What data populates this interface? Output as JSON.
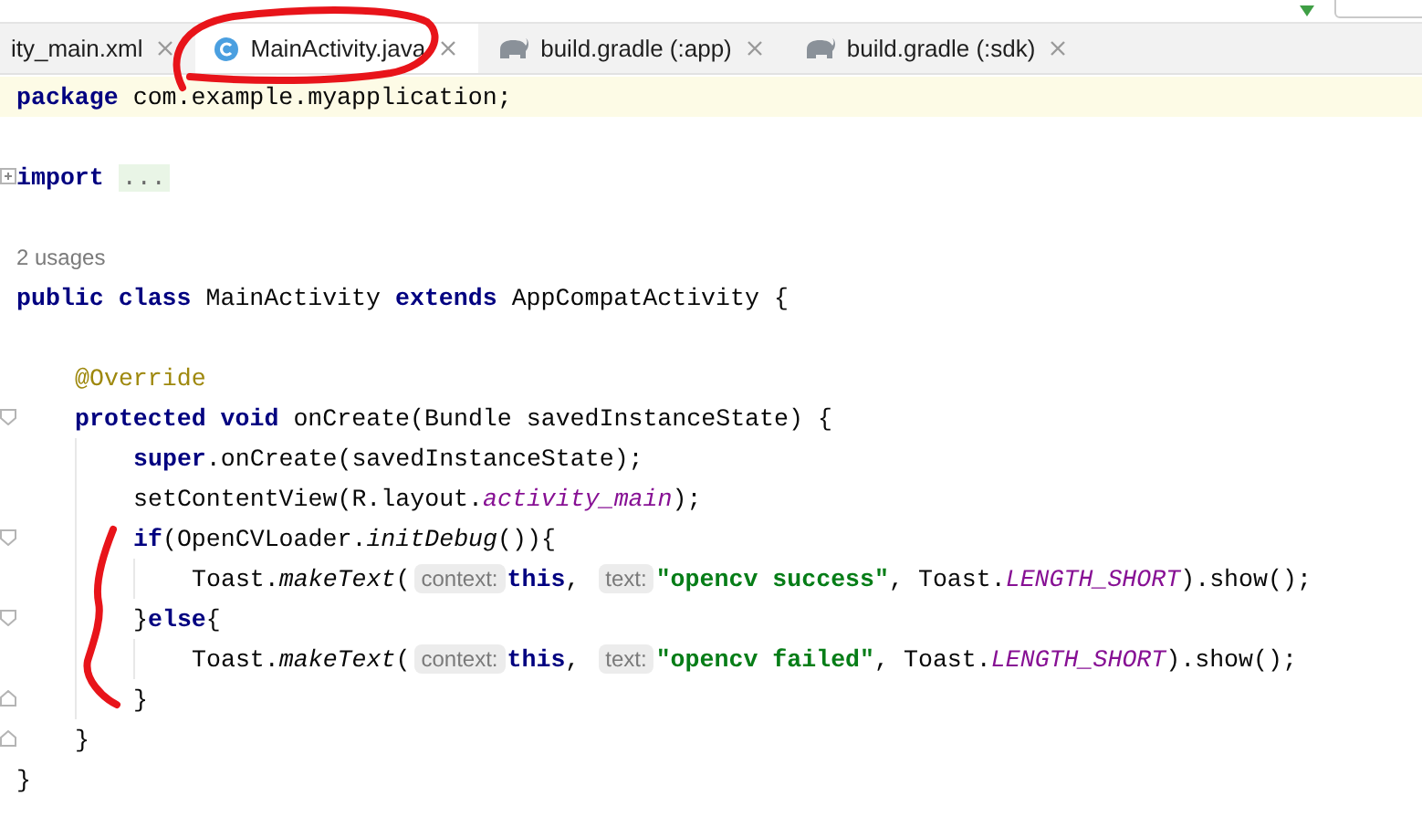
{
  "tabs": [
    {
      "label": "ity_main.xml",
      "kind": "xml",
      "selected": false
    },
    {
      "label": "MainActivity.java",
      "kind": "java",
      "selected": true
    },
    {
      "label": "build.gradle (:app)",
      "kind": "gradle",
      "selected": false
    },
    {
      "label": "build.gradle (:sdk)",
      "kind": "gradle",
      "selected": false
    }
  ],
  "lines": [
    {
      "current": true,
      "tokens": [
        {
          "kind": "kw",
          "text": "package"
        },
        {
          "kind": "plain",
          "text": " com.example.myapplication;"
        }
      ]
    },
    {
      "kind": "blank"
    },
    {
      "folded": true,
      "tokens": [
        {
          "kind": "kw",
          "text": "import"
        },
        {
          "kind": "fold",
          "text": "..."
        }
      ]
    },
    {
      "kind": "blank"
    },
    {
      "kind": "usages",
      "text": "2 usages"
    },
    {
      "tokens": [
        {
          "kind": "kw",
          "text": "public class"
        },
        {
          "kind": "plain",
          "text": " MainActivity "
        },
        {
          "kind": "kw",
          "text": "extends"
        },
        {
          "kind": "plain",
          "text": " AppCompatActivity {"
        }
      ],
      "children": [
        {
          "kind": "blank"
        },
        {
          "tokens": [
            {
              "kind": "annot",
              "text": "@Override"
            }
          ]
        },
        {
          "tokens": [
            {
              "kind": "kw",
              "text": "protected void"
            },
            {
              "kind": "plain",
              "text": " onCreate(Bundle savedInstanceState) {"
            }
          ],
          "children": [
            {
              "tokens": [
                {
                  "kind": "kw",
                  "text": "super"
                },
                {
                  "kind": "plain",
                  "text": ".onCreate(savedInstanceState);"
                }
              ]
            },
            {
              "tokens": [
                {
                  "kind": "plain",
                  "text": "setContentView(R.layout."
                },
                {
                  "kind": "static",
                  "text": "activity_main"
                },
                {
                  "kind": "plain",
                  "text": ");"
                }
              ]
            },
            {
              "tokens": [
                {
                  "kind": "kw",
                  "text": "if"
                },
                {
                  "kind": "plain",
                  "text": "(OpenCVLoader."
                },
                {
                  "kind": "italic",
                  "text": "initDebug"
                },
                {
                  "kind": "plain",
                  "text": "()){"
                }
              ],
              "children": [
                {
                  "tokens": [
                    {
                      "kind": "plain",
                      "text": "Toast."
                    },
                    {
                      "kind": "italic",
                      "text": "makeText"
                    },
                    {
                      "kind": "plain",
                      "text": "("
                    },
                    {
                      "kind": "hint",
                      "text": "context:"
                    },
                    {
                      "kind": "kw",
                      "text": "this"
                    },
                    {
                      "kind": "plain",
                      "text": ", "
                    },
                    {
                      "kind": "hint",
                      "text": "text:"
                    },
                    {
                      "kind": "str",
                      "text": "\"opencv success\""
                    },
                    {
                      "kind": "plain",
                      "text": ", Toast."
                    },
                    {
                      "kind": "static",
                      "text": "LENGTH_SHORT"
                    },
                    {
                      "kind": "plain",
                      "text": ").show();"
                    }
                  ]
                }
              ]
            },
            {
              "tokens": [
                {
                  "kind": "plain",
                  "text": "}"
                },
                {
                  "kind": "kw",
                  "text": "else"
                },
                {
                  "kind": "plain",
                  "text": "{"
                }
              ],
              "children": [
                {
                  "tokens": [
                    {
                      "kind": "plain",
                      "text": "Toast."
                    },
                    {
                      "kind": "italic",
                      "text": "makeText"
                    },
                    {
                      "kind": "plain",
                      "text": "("
                    },
                    {
                      "kind": "hint",
                      "text": "context:"
                    },
                    {
                      "kind": "kw",
                      "text": "this"
                    },
                    {
                      "kind": "plain",
                      "text": ", "
                    },
                    {
                      "kind": "hint",
                      "text": "text:"
                    },
                    {
                      "kind": "str",
                      "text": "\"opencv failed\""
                    },
                    {
                      "kind": "plain",
                      "text": ", Toast."
                    },
                    {
                      "kind": "static",
                      "text": "LENGTH_SHORT"
                    },
                    {
                      "kind": "plain",
                      "text": ").show();"
                    }
                  ]
                }
              ]
            },
            {
              "tokens": [
                {
                  "kind": "plain",
                  "text": "}"
                }
              ]
            }
          ]
        },
        {
          "tokens": [
            {
              "kind": "plain",
              "text": "}"
            }
          ]
        }
      ]
    },
    {
      "tokens": [
        {
          "kind": "plain",
          "text": "}"
        }
      ]
    }
  ]
}
